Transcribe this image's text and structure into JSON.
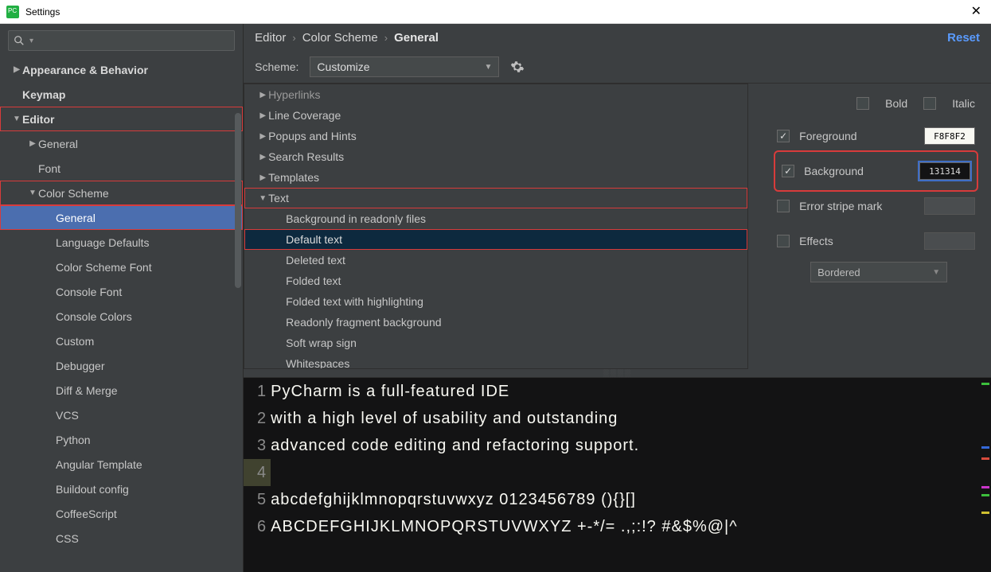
{
  "window": {
    "title": "Settings"
  },
  "search": {
    "placeholder": ""
  },
  "sidebar": {
    "items": [
      {
        "label": "Appearance & Behavior",
        "arrow": "▶",
        "bold": true
      },
      {
        "label": "Keymap",
        "arrow": "",
        "bold": true
      },
      {
        "label": "Editor",
        "arrow": "▼",
        "bold": true,
        "red": true
      },
      {
        "label": "General",
        "arrow": "▶",
        "indent": 1
      },
      {
        "label": "Font",
        "arrow": "",
        "indent": 1
      },
      {
        "label": "Color Scheme",
        "arrow": "▼",
        "indent": 1,
        "red": true
      },
      {
        "label": "General",
        "arrow": "",
        "indent": 2,
        "selected": true,
        "red": true
      },
      {
        "label": "Language Defaults",
        "arrow": "",
        "indent": 2
      },
      {
        "label": "Color Scheme Font",
        "arrow": "",
        "indent": 2
      },
      {
        "label": "Console Font",
        "arrow": "",
        "indent": 2
      },
      {
        "label": "Console Colors",
        "arrow": "",
        "indent": 2
      },
      {
        "label": "Custom",
        "arrow": "",
        "indent": 2
      },
      {
        "label": "Debugger",
        "arrow": "",
        "indent": 2
      },
      {
        "label": "Diff & Merge",
        "arrow": "",
        "indent": 2
      },
      {
        "label": "VCS",
        "arrow": "",
        "indent": 2
      },
      {
        "label": "Python",
        "arrow": "",
        "indent": 2
      },
      {
        "label": "Angular Template",
        "arrow": "",
        "indent": 2
      },
      {
        "label": "Buildout config",
        "arrow": "",
        "indent": 2
      },
      {
        "label": "CoffeeScript",
        "arrow": "",
        "indent": 2
      },
      {
        "label": "CSS",
        "arrow": "",
        "indent": 2
      }
    ]
  },
  "breadcrumb": {
    "a": "Editor",
    "b": "Color Scheme",
    "c": "General",
    "reset": "Reset"
  },
  "scheme": {
    "label": "Scheme:",
    "value": "Customize"
  },
  "categories": [
    {
      "label": "Hyperlinks",
      "arrow": "▶",
      "cut": true
    },
    {
      "label": "Line Coverage",
      "arrow": "▶"
    },
    {
      "label": "Popups and Hints",
      "arrow": "▶"
    },
    {
      "label": "Search Results",
      "arrow": "▶"
    },
    {
      "label": "Templates",
      "arrow": "▶"
    },
    {
      "label": "Text",
      "arrow": "▼",
      "red": true
    },
    {
      "label": "Background in readonly files",
      "child": true
    },
    {
      "label": "Default text",
      "child": true,
      "selected": true,
      "red": true
    },
    {
      "label": "Deleted text",
      "child": true
    },
    {
      "label": "Folded text",
      "child": true
    },
    {
      "label": "Folded text with highlighting",
      "child": true
    },
    {
      "label": "Readonly fragment background",
      "child": true
    },
    {
      "label": "Soft wrap sign",
      "child": true
    },
    {
      "label": "Whitespaces",
      "child": true
    }
  ],
  "props": {
    "bold": "Bold",
    "italic": "Italic",
    "foreground": {
      "label": "Foreground",
      "value": "F8F8F2",
      "color": "#F8F8F2",
      "checked": true
    },
    "background": {
      "label": "Background",
      "value": "131314",
      "color": "#131314",
      "checked": true
    },
    "error_stripe": {
      "label": "Error stripe mark",
      "checked": false
    },
    "effects": {
      "label": "Effects",
      "checked": false,
      "type": "Bordered"
    }
  },
  "preview": {
    "lines": [
      {
        "n": "1",
        "t": "PyCharm is a full-featured IDE"
      },
      {
        "n": "2",
        "t": "with a high level of usability and outstanding"
      },
      {
        "n": "3",
        "t": "advanced code editing and refactoring support."
      },
      {
        "n": "4",
        "t": "",
        "current": true
      },
      {
        "n": "5",
        "t": "abcdefghijklmnopqrstuvwxyz 0123456789 (){}[]"
      },
      {
        "n": "6",
        "t": "ABCDEFGHIJKLMNOPQRSTUVWXYZ +-*/= .,;:!? #&$%@|^"
      }
    ]
  }
}
